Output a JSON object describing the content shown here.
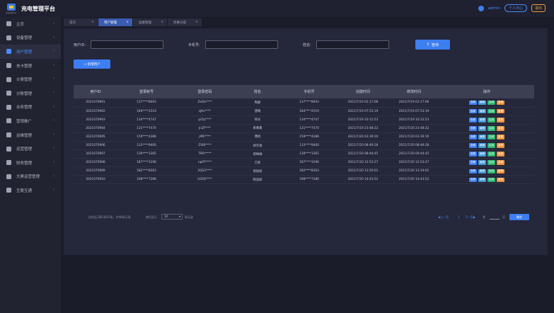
{
  "app": {
    "title": "充电管理平台",
    "logo_caption": "充电管理平台"
  },
  "header": {
    "username": "admin",
    "personal_center": "个人中心",
    "logout": "退出"
  },
  "sidebar": {
    "items": [
      {
        "label": "主页",
        "icon": "home-icon"
      },
      {
        "label": "设备管理",
        "icon": "device-icon"
      },
      {
        "label": "用户管理",
        "icon": "user-icon",
        "active": true
      },
      {
        "label": "充卡管理",
        "icon": "card-icon"
      },
      {
        "label": "计费管理",
        "icon": "billing-icon"
      },
      {
        "label": "分账管理",
        "icon": "split-icon"
      },
      {
        "label": "业务管理",
        "icon": "business-icon"
      },
      {
        "label": "营销推广",
        "icon": "share-icon"
      },
      {
        "label": "运维管理",
        "icon": "wrench-icon"
      },
      {
        "label": "运营管理",
        "icon": "operation-icon"
      },
      {
        "label": "财务管理",
        "icon": "finance-icon"
      },
      {
        "label": "大屏运营管理",
        "icon": "screen-icon"
      },
      {
        "label": "互联互通",
        "icon": "link-icon"
      }
    ]
  },
  "tabs": [
    {
      "label": "首页",
      "active": false
    },
    {
      "label": "用户管理",
      "active": true
    },
    {
      "label": "运维管理",
      "active": false
    },
    {
      "label": "优惠分成",
      "active": false
    }
  ],
  "search": {
    "user_id_label": "用户ID:",
    "phone_label": "手机号:",
    "name_label": "姓名:",
    "user_id_value": "",
    "phone_value": "",
    "name_value": "",
    "search_button": "查询",
    "add_button": "+ 新增用户"
  },
  "table": {
    "columns": [
      "用户ID",
      "登录帐号",
      "登录密码",
      "姓名",
      "手机号",
      "创建时间",
      "修改时间",
      "操作"
    ],
    "actions": [
      "查看",
      "编辑",
      "启用",
      "重置"
    ],
    "rows": [
      [
        "2021070901",
        "137****8093",
        "ZxDa****",
        "陶婕",
        "137****8093",
        "2021/7/19 02:17:06",
        "2021/7/19 02:17:06"
      ],
      [
        "2021070902",
        "184****2519",
        "sJKs****",
        "唐婧",
        "184****2519",
        "2021/7/19 07:53:19",
        "2021/7/19 07:53:19"
      ],
      [
        "2021070903",
        "134****4747",
        "piZq****",
        "杨光",
        "134****4747",
        "2021/7/19 10:12:53",
        "2021/7/19 10:12:53"
      ],
      [
        "2021070904",
        "131****7470",
        "JnZf****",
        "黄菁菁",
        "131****7470",
        "2021/7/19 23:48:22",
        "2021/7/20 23:48:22"
      ],
      [
        "2021070905",
        "159****4286",
        "jIPK****",
        "傅扬",
        "159****4286",
        "2021/7/20 03:39:10",
        "2021/7/20 03:39:10"
      ],
      [
        "2021070906",
        "133****9400",
        "ZXBl****",
        "胡宇涵",
        "133****9400",
        "2021/7/20 08:49:28",
        "2021/7/20 08:49:28"
      ],
      [
        "2021070907",
        "139****3365",
        "TRPr****",
        "郝琳琳",
        "139****3365",
        "2021/7/20 08:44:45",
        "2021/7/20 09:44:45"
      ],
      [
        "2021070908",
        "187****3196",
        "npAT****",
        "吉莉",
        "187****3196",
        "2021/7/20 12:53:27",
        "2021/7/20 12:53:27"
      ],
      [
        "2021070909",
        "182****8263",
        "2QS3****",
        "谢丽丽",
        "182****8263",
        "2021/7/20 13:20:01",
        "2021/7/20 13:19:01"
      ],
      [
        "2021070910",
        "198****7286",
        "U2DE****",
        "韩淑斌",
        "198****7286",
        "2021/7/20 14:43:52",
        "2021/7/20 14:43:52"
      ]
    ]
  },
  "pagination": {
    "info": "当前显示第1到10条，共48条记录",
    "per_page_prefix": "每页显示",
    "per_page_value": "10",
    "per_page_suffix": "条记录",
    "prev": "◀上一页",
    "page_num": "1",
    "next": "下一页▶",
    "goto": "到",
    "page_suffix": "页",
    "jump": "确定"
  },
  "colors": {
    "accent": "#3d7ef0",
    "enable": "#2bb673",
    "reset": "#f0923a",
    "sidebar_bg": "#222331",
    "panel_bg": "#25273a"
  }
}
